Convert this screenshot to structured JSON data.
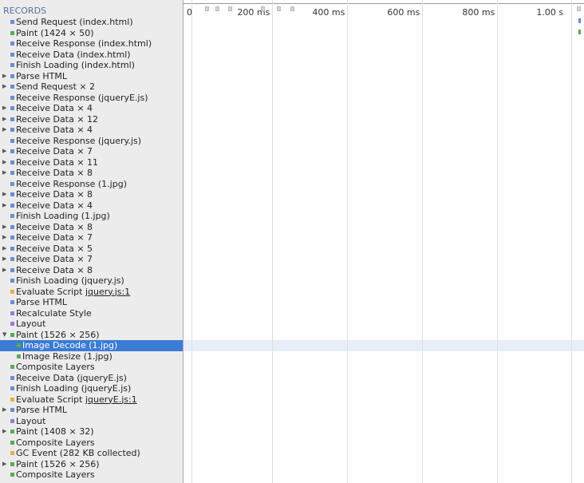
{
  "sidebar": {
    "header": "RECORDS",
    "records": [
      {
        "label": "Send Request (index.html)",
        "color": "#6a8fd0",
        "expand": "",
        "indent": 0
      },
      {
        "label": "Paint (1424 × 50)",
        "color": "#5aaa55",
        "expand": "",
        "indent": 0
      },
      {
        "label": "Receive Response (index.html)",
        "color": "#6a8fd0",
        "expand": "",
        "indent": 0
      },
      {
        "label": "Receive Data (index.html)",
        "color": "#6a8fd0",
        "expand": "",
        "indent": 0
      },
      {
        "label": "Finish Loading (index.html)",
        "color": "#6a8fd0",
        "expand": "",
        "indent": 0
      },
      {
        "label": "Parse HTML",
        "color": "#6a8fd0",
        "expand": "right",
        "indent": 0
      },
      {
        "label": "Send Request × 2",
        "color": "#6a8fd0",
        "expand": "right",
        "indent": 0
      },
      {
        "label": "Receive Response (jqueryE.js)",
        "color": "#6a8fd0",
        "expand": "",
        "indent": 0
      },
      {
        "label": "Receive Data × 4",
        "color": "#6a8fd0",
        "expand": "right",
        "indent": 0
      },
      {
        "label": "Receive Data × 12",
        "color": "#6a8fd0",
        "expand": "right",
        "indent": 0
      },
      {
        "label": "Receive Data × 4",
        "color": "#6a8fd0",
        "expand": "right",
        "indent": 0
      },
      {
        "label": "Receive Response (jquery.js)",
        "color": "#6a8fd0",
        "expand": "",
        "indent": 0
      },
      {
        "label": "Receive Data × 7",
        "color": "#6a8fd0",
        "expand": "right",
        "indent": 0
      },
      {
        "label": "Receive Data × 11",
        "color": "#6a8fd0",
        "expand": "right",
        "indent": 0
      },
      {
        "label": "Receive Data × 8",
        "color": "#6a8fd0",
        "expand": "right",
        "indent": 0
      },
      {
        "label": "Receive Response (1.jpg)",
        "color": "#6a8fd0",
        "expand": "",
        "indent": 0
      },
      {
        "label": "Receive Data × 8",
        "color": "#6a8fd0",
        "expand": "right",
        "indent": 0
      },
      {
        "label": "Receive Data × 4",
        "color": "#6a8fd0",
        "expand": "right",
        "indent": 0
      },
      {
        "label": "Finish Loading (1.jpg)",
        "color": "#6a8fd0",
        "expand": "",
        "indent": 0
      },
      {
        "label": "Receive Data × 8",
        "color": "#6a8fd0",
        "expand": "right",
        "indent": 0
      },
      {
        "label": "Receive Data × 7",
        "color": "#6a8fd0",
        "expand": "right",
        "indent": 0
      },
      {
        "label": "Receive Data × 5",
        "color": "#6a8fd0",
        "expand": "right",
        "indent": 0
      },
      {
        "label": "Receive Data × 7",
        "color": "#6a8fd0",
        "expand": "right",
        "indent": 0
      },
      {
        "label": "Receive Data × 8",
        "color": "#6a8fd0",
        "expand": "right",
        "indent": 0
      },
      {
        "label": "Finish Loading (jquery.js)",
        "color": "#6a8fd0",
        "expand": "",
        "indent": 0
      },
      {
        "label": "Evaluate Script ",
        "link": "jquery.js:1",
        "color": "#e8b04a",
        "expand": "",
        "indent": 0
      },
      {
        "label": "Parse HTML",
        "color": "#6a8fd0",
        "expand": "",
        "indent": 0
      },
      {
        "label": "Recalculate Style",
        "color": "#9a7ad8",
        "expand": "",
        "indent": 0
      },
      {
        "label": "Layout",
        "color": "#9a7ad8",
        "expand": "",
        "indent": 0
      },
      {
        "label": "Paint (1526 × 256)",
        "color": "#5aaa55",
        "expand": "down",
        "indent": 0
      },
      {
        "label": "Image Decode (1.jpg)",
        "color": "#5aaa55",
        "expand": "",
        "indent": 1,
        "selected": true
      },
      {
        "label": "Image Resize (1.jpg)",
        "color": "#5aaa55",
        "expand": "",
        "indent": 1
      },
      {
        "label": "Composite Layers",
        "color": "#5aaa55",
        "expand": "",
        "indent": 0
      },
      {
        "label": "Receive Data (jqueryE.js)",
        "color": "#6a8fd0",
        "expand": "",
        "indent": 0
      },
      {
        "label": "Finish Loading (jqueryE.js)",
        "color": "#6a8fd0",
        "expand": "",
        "indent": 0
      },
      {
        "label": "Evaluate Script ",
        "link": "jqueryE.js:1",
        "color": "#e8b04a",
        "expand": "",
        "indent": 0
      },
      {
        "label": "Parse HTML",
        "color": "#6a8fd0",
        "expand": "right",
        "indent": 0
      },
      {
        "label": "Layout",
        "color": "#9a7ad8",
        "expand": "",
        "indent": 0
      },
      {
        "label": "Paint (1408 × 32)",
        "color": "#5aaa55",
        "expand": "right",
        "indent": 0
      },
      {
        "label": "Composite Layers",
        "color": "#5aaa55",
        "expand": "",
        "indent": 0
      },
      {
        "label": "GC Event (282 KB collected)",
        "color": "#e8b04a",
        "expand": "",
        "indent": 0
      },
      {
        "label": "Paint (1526 × 256)",
        "color": "#5aaa55",
        "expand": "right",
        "indent": 0
      },
      {
        "label": "Composite Layers",
        "color": "#5aaa55",
        "expand": "",
        "indent": 0
      }
    ]
  },
  "timeline": {
    "ticks": [
      "0",
      "200 ms",
      "400 ms",
      "600 ms",
      "800 ms",
      "1.00 s"
    ],
    "colors": {
      "grid": "#e0e0e0",
      "selected_band": "#e7eef8",
      "loading": "#6a8fd0",
      "painting": "#5aaa55"
    }
  }
}
